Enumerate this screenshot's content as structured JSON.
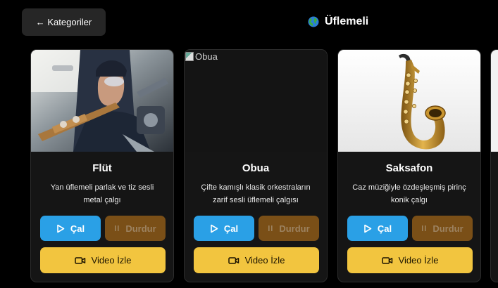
{
  "header": {
    "back_label": "← Kategoriler",
    "title": "Üflemeli",
    "title_icon": "globe-icon"
  },
  "cards": [
    {
      "title": "Flüt",
      "description": "Yan üflemeli parlak ve tiz sesli metal çalgı",
      "image": "flute-player-photo",
      "image_alt": "",
      "play_label": "Çal",
      "stop_label": "Durdur",
      "video_label": "Video İzle"
    },
    {
      "title": "Obua",
      "description": "Çifte kamışlı klasik orkestraların zarif sesli üflemeli çalgısı",
      "image": "broken-image",
      "image_alt": "Obua",
      "play_label": "Çal",
      "stop_label": "Durdur",
      "video_label": "Video İzle"
    },
    {
      "title": "Saksafon",
      "description": "Caz müziğiyle özdeşleşmiş pirinç konik çalgı",
      "image": "saxophone-photo",
      "image_alt": "",
      "play_label": "Çal",
      "stop_label": "Durdur",
      "video_label": "Video İzle"
    }
  ],
  "colors": {
    "background": "#000000",
    "card": "#151515",
    "play": "#2aa0e6",
    "stop": "#7a4f17",
    "video": "#f2c53f"
  }
}
